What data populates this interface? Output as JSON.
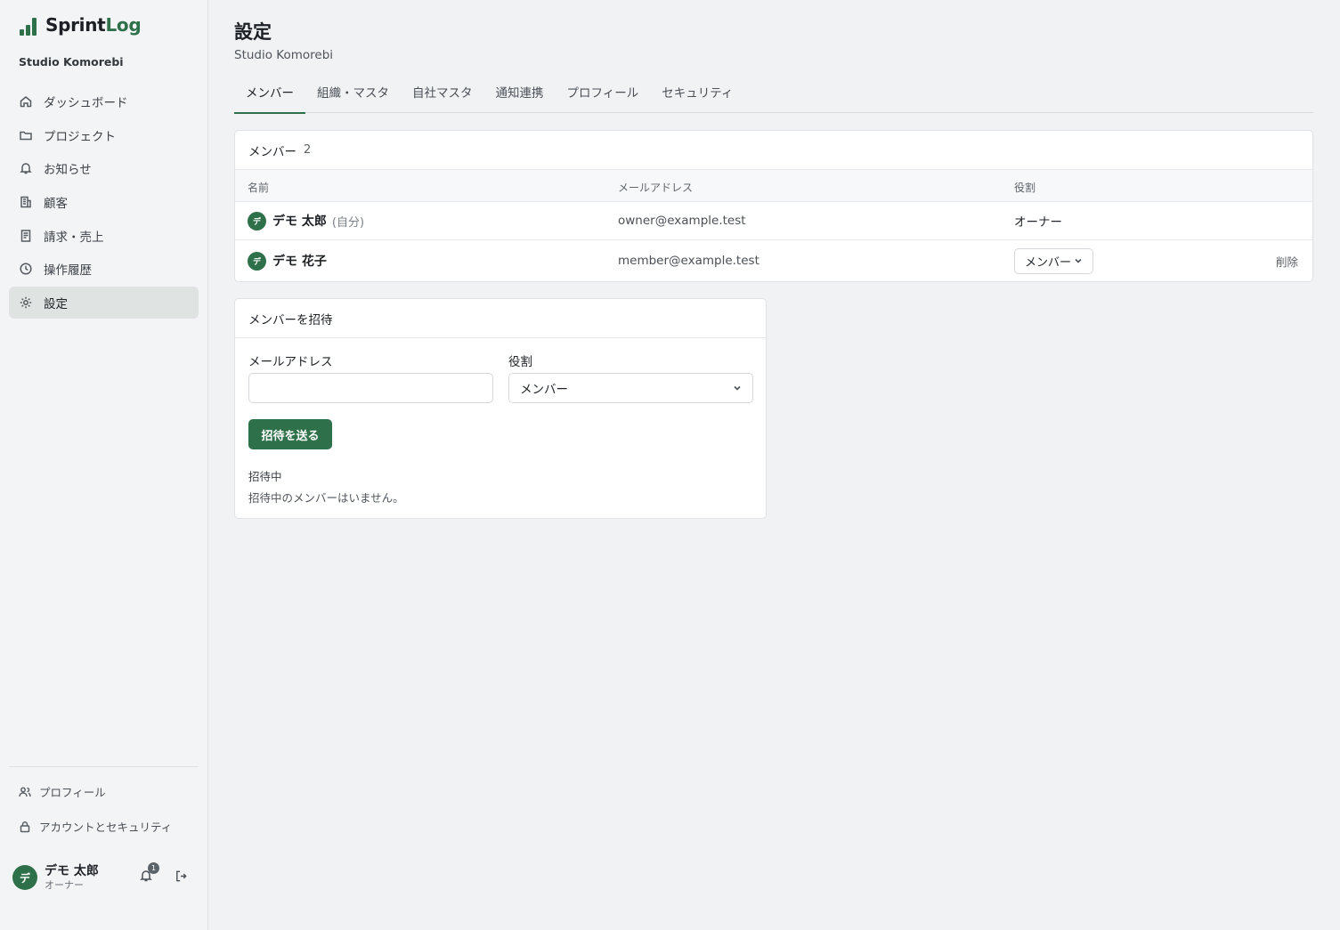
{
  "app": {
    "logo_part1": "Sprint",
    "logo_part2": "Log",
    "org_name": "Studio Komorebi",
    "brand_color": "#2e7049"
  },
  "sidebar": {
    "items": [
      {
        "label": "ダッシュボード",
        "icon": "home-icon"
      },
      {
        "label": "プロジェクト",
        "icon": "folder-icon"
      },
      {
        "label": "お知らせ",
        "icon": "bell-icon"
      },
      {
        "label": "顧客",
        "icon": "building-icon"
      },
      {
        "label": "請求・売上",
        "icon": "receipt-icon"
      },
      {
        "label": "操作履歴",
        "icon": "clock-icon"
      },
      {
        "label": "設定",
        "icon": "gear-icon",
        "active": true
      }
    ],
    "bottom_links": [
      {
        "label": "プロフィール",
        "icon": "users-icon"
      },
      {
        "label": "アカウントとセキュリティ",
        "icon": "lock-icon"
      }
    ],
    "user": {
      "avatar_initial": "デ",
      "name": "デモ 太郎",
      "role": "オーナー",
      "notification_count": "1"
    }
  },
  "page": {
    "title": "設定",
    "subtitle": "Studio Komorebi"
  },
  "tabs": [
    "メンバー",
    "組織・マスタ",
    "自社マスタ",
    "通知連携",
    "プロフィール",
    "セキュリティ"
  ],
  "active_tab": "メンバー",
  "members": {
    "heading": "メンバー",
    "count": "2",
    "columns": {
      "name": "名前",
      "email": "メールアドレス",
      "role": "役割"
    },
    "rows": [
      {
        "initial": "デ",
        "name": "デモ 太郎",
        "self_tag": "(自分)",
        "email": "owner@example.test",
        "role": "オーナー"
      },
      {
        "initial": "デ",
        "name": "デモ 花子",
        "email": "member@example.test",
        "role": "メンバー",
        "action": "削除"
      }
    ]
  },
  "invite": {
    "heading": "メンバーを招待",
    "email_label": "メールアドレス",
    "email_value": "",
    "role_label": "役割",
    "role_value": "メンバー",
    "submit_label": "招待を送る",
    "pending_title": "招待中",
    "pending_empty": "招待中のメンバーはいません。"
  }
}
